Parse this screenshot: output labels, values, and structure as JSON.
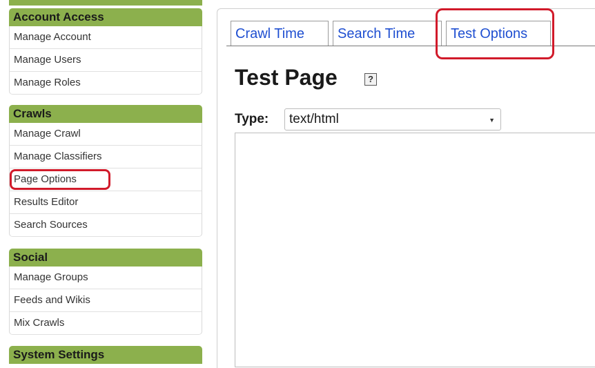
{
  "sidebar": {
    "account_access": {
      "header": "Account Access",
      "items": [
        "Manage Account",
        "Manage Users",
        "Manage Roles"
      ]
    },
    "crawls": {
      "header": "Crawls",
      "items": [
        "Manage Crawl",
        "Manage Classifiers",
        "Page Options",
        "Results Editor",
        "Search Sources"
      ]
    },
    "social": {
      "header": "Social",
      "items": [
        "Manage Groups",
        "Feeds and Wikis",
        "Mix Crawls"
      ]
    },
    "system_settings": {
      "header": "System Settings"
    }
  },
  "tabs": [
    "Crawl Time",
    "Search Time",
    "Test Options"
  ],
  "page": {
    "title": "Test Page",
    "help": "?",
    "type_label": "Type:",
    "type_value": "text/html"
  },
  "colors": {
    "header_green": "#8cb04d",
    "tab_link": "#1f4fd1",
    "highlight_ring": "#d11a2a"
  }
}
